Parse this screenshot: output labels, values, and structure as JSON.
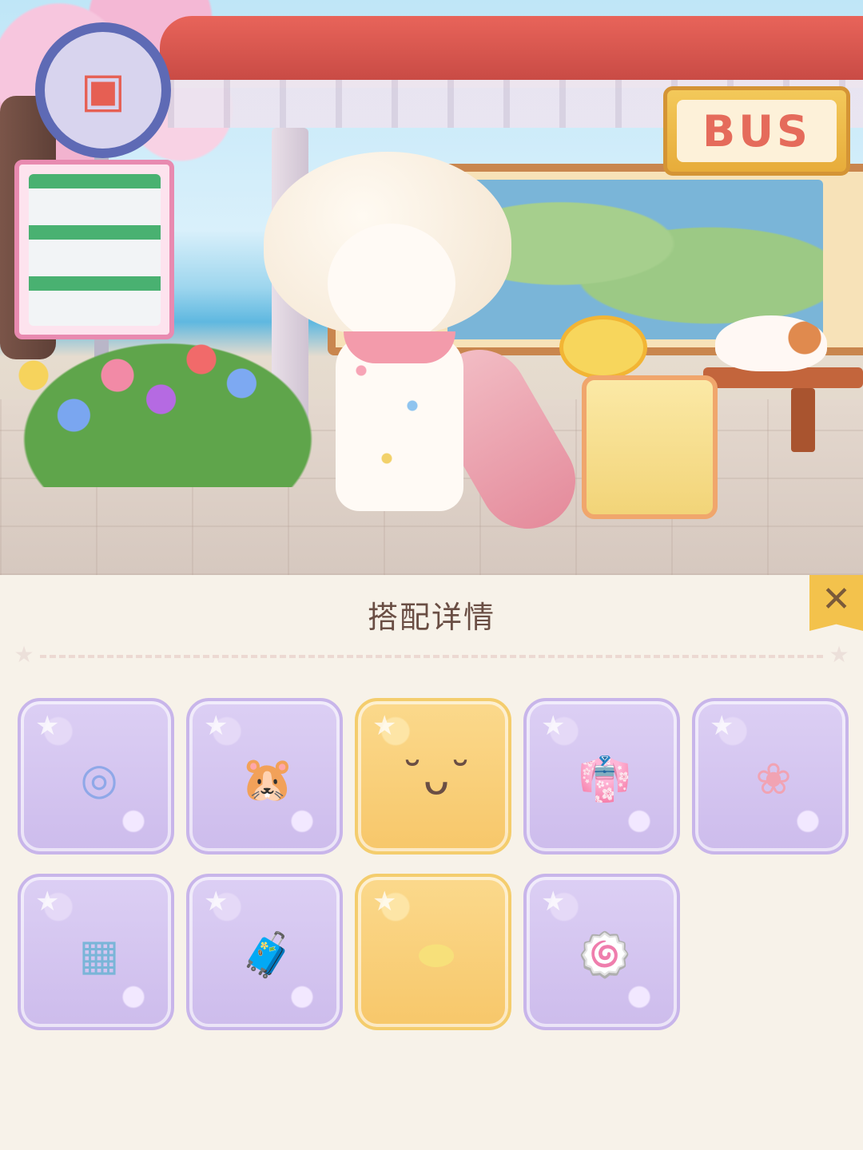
{
  "scene": {
    "bus_sign_text": "BUS",
    "colors": {
      "roof": "#d85a50",
      "bus_sign": "#f3c95a",
      "panel_bg": "#f7f2e9",
      "slot_purple": "#cdbcec",
      "slot_gold": "#f7c76a",
      "close_button": "#f3c24c"
    }
  },
  "panel": {
    "title": "搭配详情",
    "close_icon": "close-icon"
  },
  "items": [
    {
      "name": "ripple-effect-icon",
      "glyph": "◎",
      "color": "#8fa8e8",
      "rarity": "purple"
    },
    {
      "name": "hamster-sticker-icon",
      "glyph": "🐹",
      "color": "#f0a38a",
      "rarity": "purple"
    },
    {
      "name": "sleepy-face-icon",
      "glyph": "˘ᴗ˘",
      "color": "#6a4e44",
      "rarity": "gold"
    },
    {
      "name": "pajama-outfit-icon",
      "glyph": "👘",
      "color": "#f39bab",
      "rarity": "purple"
    },
    {
      "name": "pink-hair-icon",
      "glyph": "❀",
      "color": "#f1a3b3",
      "rarity": "purple"
    },
    {
      "name": "bus-stop-background-icon",
      "glyph": "▦",
      "color": "#7ab5d8",
      "rarity": "purple"
    },
    {
      "name": "suitcase-icon",
      "glyph": "🧳",
      "color": "#f2d478",
      "rarity": "purple"
    },
    {
      "name": "yellow-pillow-icon",
      "glyph": "⬬",
      "color": "#f7e07a",
      "rarity": "gold"
    },
    {
      "name": "swiss-roll-icon",
      "glyph": "🍥",
      "color": "#7fa05a",
      "rarity": "purple"
    }
  ]
}
